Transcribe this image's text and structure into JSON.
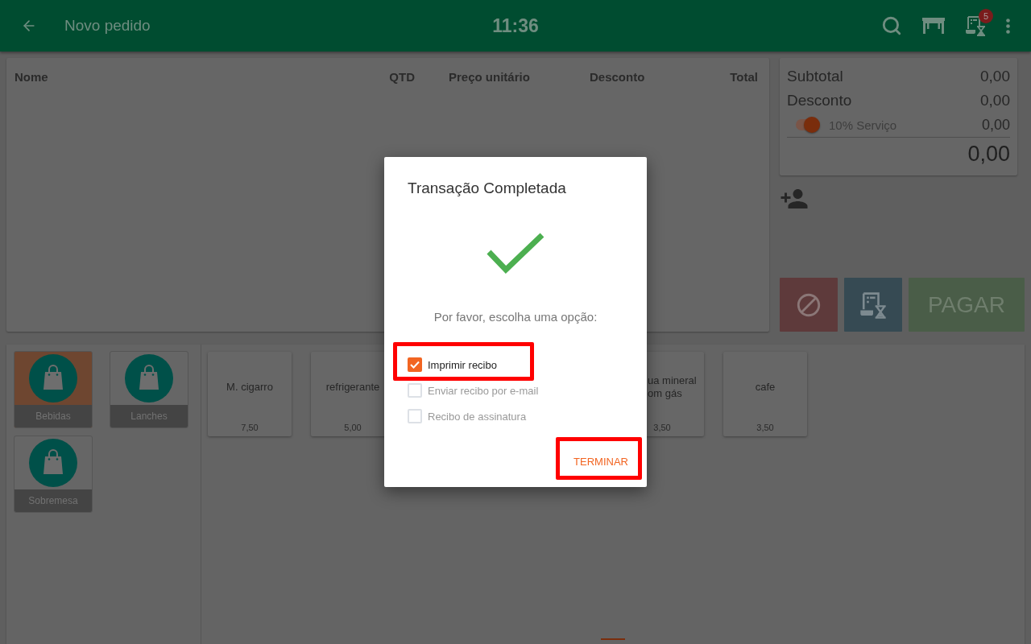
{
  "top_bar": {
    "title": "Novo pedido",
    "time": "11:36",
    "badge": "5"
  },
  "order_table": {
    "columns": [
      "Nome",
      "QTD",
      "Preço unitário",
      "Desconto",
      "Total"
    ]
  },
  "totals": {
    "rows": [
      {
        "label": "Subtotal",
        "value": "0,00"
      },
      {
        "label": "Desconto",
        "value": "0,00"
      }
    ],
    "service": {
      "label": "10% Serviço",
      "value": "0,00",
      "on": true
    },
    "total": "0,00"
  },
  "actions": {
    "pay_label": "PAGAR"
  },
  "categories": [
    {
      "name": "Bebidas",
      "selected": true
    },
    {
      "name": "Lanches",
      "selected": false
    },
    {
      "name": "Sobremesa",
      "selected": false
    }
  ],
  "products": [
    {
      "name": "M. cigarro",
      "price": "7,50",
      "clipped": false
    },
    {
      "name": "refrigerante",
      "price": "5,00",
      "clipped": false
    },
    {
      "name": "ua mineral\nom gás",
      "price": "3,50",
      "clipped": true
    },
    {
      "name": "cafe",
      "price": "3,50",
      "clipped": false
    }
  ],
  "dialog": {
    "title": "Transação Completada",
    "prompt": "Por favor, escolha uma opção:",
    "options": [
      {
        "label": "Imprimir recibo",
        "checked": true,
        "disabled": false,
        "highlighted": true
      },
      {
        "label": "Enviar recibo por e-mail",
        "checked": false,
        "disabled": true,
        "highlighted": false
      },
      {
        "label": "Recibo de assinatura",
        "checked": false,
        "disabled": true,
        "highlighted": false
      }
    ],
    "button": {
      "label": "TERMINAR",
      "highlighted": true
    }
  }
}
